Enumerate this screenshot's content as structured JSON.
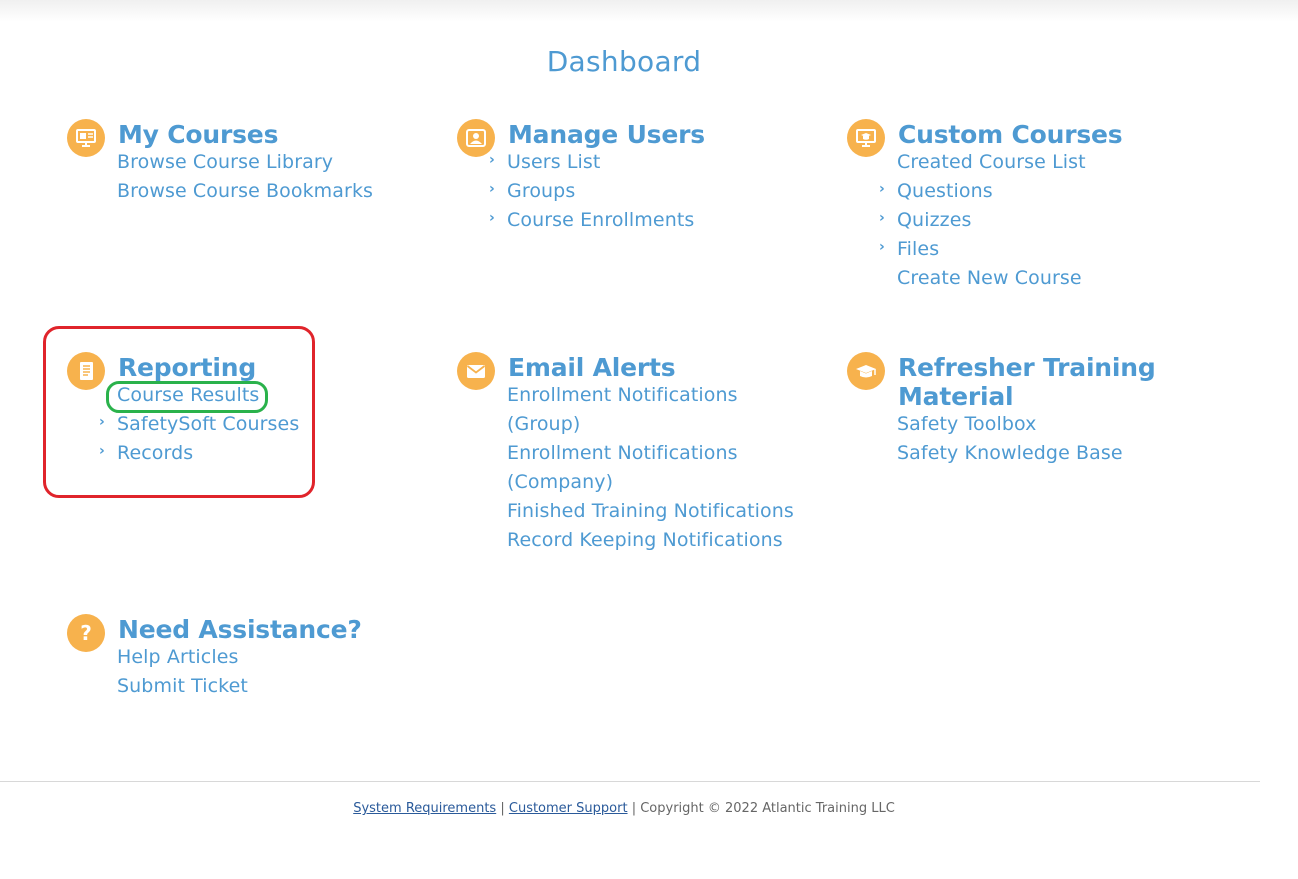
{
  "page": {
    "title": "Dashboard"
  },
  "sections": {
    "my_courses": {
      "title": "My Courses",
      "icon": "presentation-icon",
      "links": [
        "Browse Course Library",
        "Browse Course Bookmarks"
      ]
    },
    "manage_users": {
      "title": "Manage Users",
      "icon": "user-card-icon",
      "links": [
        "Users List",
        "Groups",
        "Course Enrollments"
      ]
    },
    "custom_courses": {
      "title": "Custom Courses",
      "icon": "monitor-graduation-icon",
      "links": [
        "Created Course List",
        "Questions",
        "Quizzes",
        "Files",
        "Create New Course"
      ]
    },
    "reporting": {
      "title": "Reporting",
      "icon": "report-document-icon",
      "links": [
        "Course Results",
        "SafetySoft Courses",
        "Records"
      ]
    },
    "email_alerts": {
      "title": "Email Alerts",
      "icon": "envelope-icon",
      "links": [
        "Enrollment Notifications",
        "(Group)",
        "Enrollment Notifications",
        "(Company)",
        "Finished Training Notifications",
        "Record Keeping Notifications"
      ]
    },
    "refresher": {
      "title_line1": "Refresher Training",
      "title_line2": "Material",
      "icon": "graduation-cap-icon",
      "links": [
        "Safety Toolbox",
        "Safety Knowledge Base"
      ]
    },
    "assistance": {
      "title": "Need Assistance?",
      "icon": "question-icon",
      "links": [
        "Help Articles",
        "Submit Ticket"
      ]
    }
  },
  "footer": {
    "system_requirements": "System Requirements",
    "separator": "|",
    "customer_support": "Customer Support",
    "copyright": "Copyright © 2022 Atlantic Training LLC"
  },
  "colors": {
    "accent": "#4e9ad2",
    "icon_bg": "#f7b24d",
    "highlight_red": "#e0242b",
    "highlight_green": "#2ab24b"
  }
}
